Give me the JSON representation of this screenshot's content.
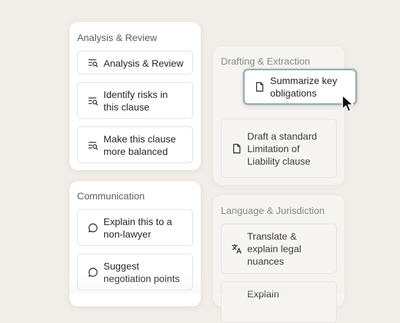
{
  "analysis": {
    "title": "Analysis & Review",
    "items": [
      {
        "label": "Analysis & Review",
        "icon": "search-list-icon"
      },
      {
        "label": "Identify risks in this clause",
        "icon": "search-list-icon"
      },
      {
        "label": "Make this clause more balanced",
        "icon": "search-list-icon"
      }
    ]
  },
  "communication": {
    "title": "Communication",
    "items": [
      {
        "label": "Explain this to a non-lawyer",
        "icon": "chat-bubble-icon"
      },
      {
        "label": "Suggest negotiation points",
        "icon": "chat-bubble-icon"
      }
    ]
  },
  "drafting": {
    "title": "Drafting & Extraction",
    "items": [
      {
        "label": "Summarize key obligations",
        "icon": "document-icon"
      },
      {
        "label": "Draft a standard Limitation of Liability clause",
        "icon": "document-icon"
      }
    ]
  },
  "language": {
    "title": "Language & Jurisdiction",
    "items": [
      {
        "label": "Translate & explain legal nuances",
        "icon": "translate-icon"
      },
      {
        "label": "Explain",
        "icon": "translate-icon"
      }
    ]
  },
  "colors": {
    "background": "#f1ede8",
    "accent": "#5f8c7f"
  }
}
